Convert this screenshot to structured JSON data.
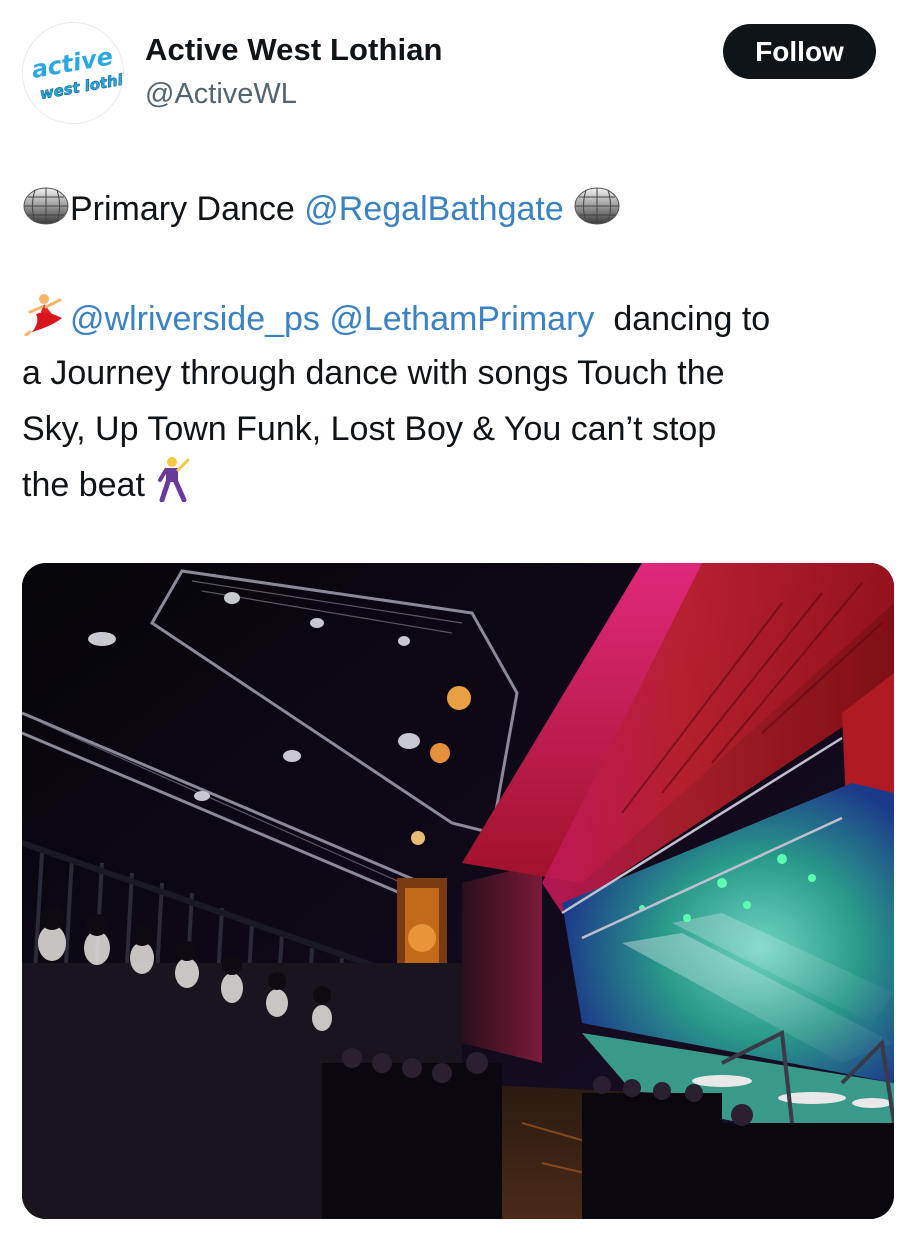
{
  "account": {
    "display_name": "Active West Lothian",
    "handle": "@ActiveWL",
    "avatar_text_top": "active",
    "avatar_text_bottom": "west lothian"
  },
  "follow_button": {
    "label": "Follow"
  },
  "tweet": {
    "line1": {
      "emoji_left": "mirror-ball",
      "text": "Primary Dance",
      "mention": "@RegalBathgate",
      "emoji_right": "mirror-ball"
    },
    "line2": {
      "emoji": "woman-dancing",
      "mention1": "@wlriverside_ps",
      "mention2": "@LethamPrimary",
      "text": "dancing to"
    },
    "line3": "a Journey through dance  with songs Touch the",
    "line4": "Sky, Up Town Funk, Lost Boy & You can’t stop",
    "line5": {
      "text": "the beat",
      "emoji": "man-dancing"
    }
  },
  "media": {
    "kind": "photo",
    "subject": "theatre-auditorium-stage"
  },
  "colors": {
    "text": "#0f1419",
    "secondary": "#536471",
    "mention": "#3b82c4",
    "follow_bg": "#0f1419",
    "follow_text": "#ffffff",
    "brand_blue": "#29a9e0"
  }
}
